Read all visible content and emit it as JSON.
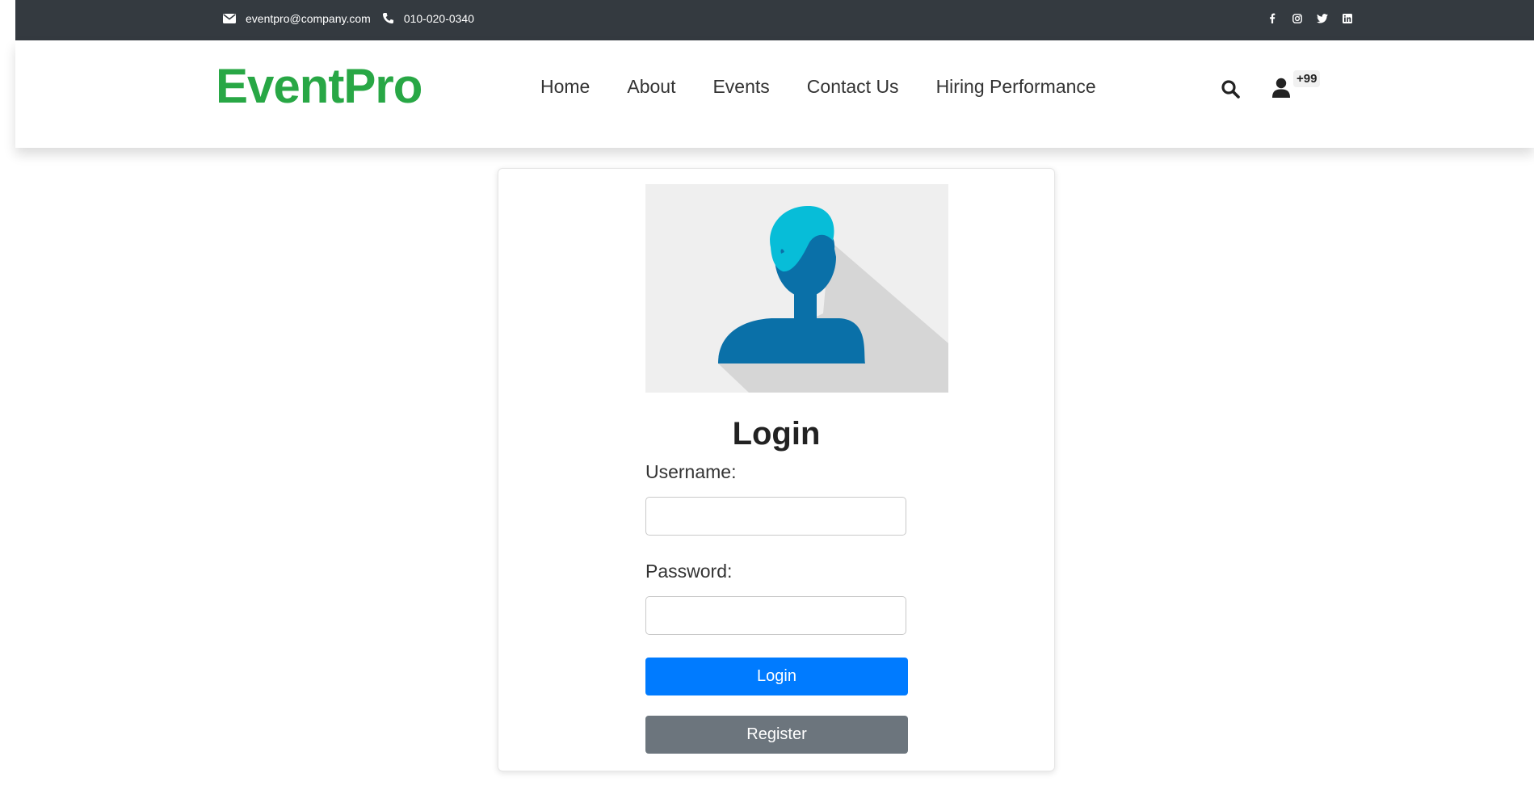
{
  "topbar": {
    "email": "eventpro@company.com",
    "phone": "010-020-0340",
    "email_icon": "envelope-icon",
    "phone_icon": "phone-icon",
    "social_icons": [
      "facebook-icon",
      "instagram-icon",
      "twitter-icon",
      "linkedin-icon"
    ]
  },
  "header": {
    "brand": "EventPro",
    "nav": [
      "Home",
      "About",
      "Events",
      "Contact Us",
      "Hiring Performance"
    ],
    "search_icon": "search-icon",
    "user_icon": "user-icon",
    "badge": "+99"
  },
  "login": {
    "title": "Login",
    "username_label": "Username:",
    "username_value": "",
    "password_label": "Password:",
    "password_value": "",
    "login_button": "Login",
    "register_button": "Register"
  },
  "colors": {
    "topbar_bg": "#343a40",
    "brand": "#28a745",
    "primary": "#007bff",
    "secondary": "#6c757d",
    "avatar_hair": "#07bdd8",
    "avatar_body": "#0a70a8"
  }
}
